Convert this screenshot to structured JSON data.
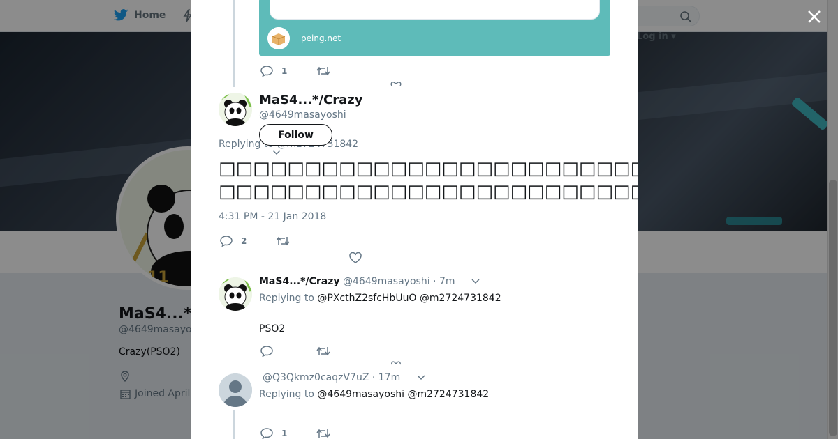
{
  "nav": {
    "home_label": "Home",
    "login_label": "Log in"
  },
  "profile": {
    "name": "MaS4...*/",
    "handle": "@4649masayo",
    "bio": "Crazy(PSO2)",
    "joined": "Joined April"
  },
  "modal": {
    "card": {
      "domain": "peing.net"
    },
    "prev_tweet": {
      "reply_count": "1"
    },
    "main_tweet": {
      "display_name": "MaS4...*/Crazy",
      "handle": "@4649masayoshi",
      "follow_label": "Follow",
      "replying_to": "Replying to @m2724731842",
      "text_line1": "□□□□□□□□□□□□□□□□□□□□□□□□□Linux□□□□□□□□□□□□□□□□□□□□□□□□",
      "text_line2": "□□□□□□□□□□□□□□□□□□□□□□□□□□□□□□□□□□□□□□□□□□□□□□□□□□□□□□□□",
      "timestamp": "4:31 PM - 21 Jan 2018",
      "reply_count": "2"
    },
    "replies": [
      {
        "display_name": "MaS4...*/Crazy",
        "handle": "@4649masayoshi",
        "time": "· 7m",
        "replying_prefix": "Replying to",
        "mentions": "@PXcthZ2sfcHbUuO @m2724731842",
        "text": "PSO2"
      },
      {
        "display_name": "",
        "handle": "@Q3Qkmz0caqzV7uZ",
        "time": "· 17m",
        "replying_prefix": "Replying to",
        "mentions": "@4649masayoshi @m2724731842",
        "reply_count": "1"
      }
    ]
  },
  "colors": {
    "card_bg": "#5ebbb9",
    "muted": "#657786",
    "text": "#14171a"
  }
}
